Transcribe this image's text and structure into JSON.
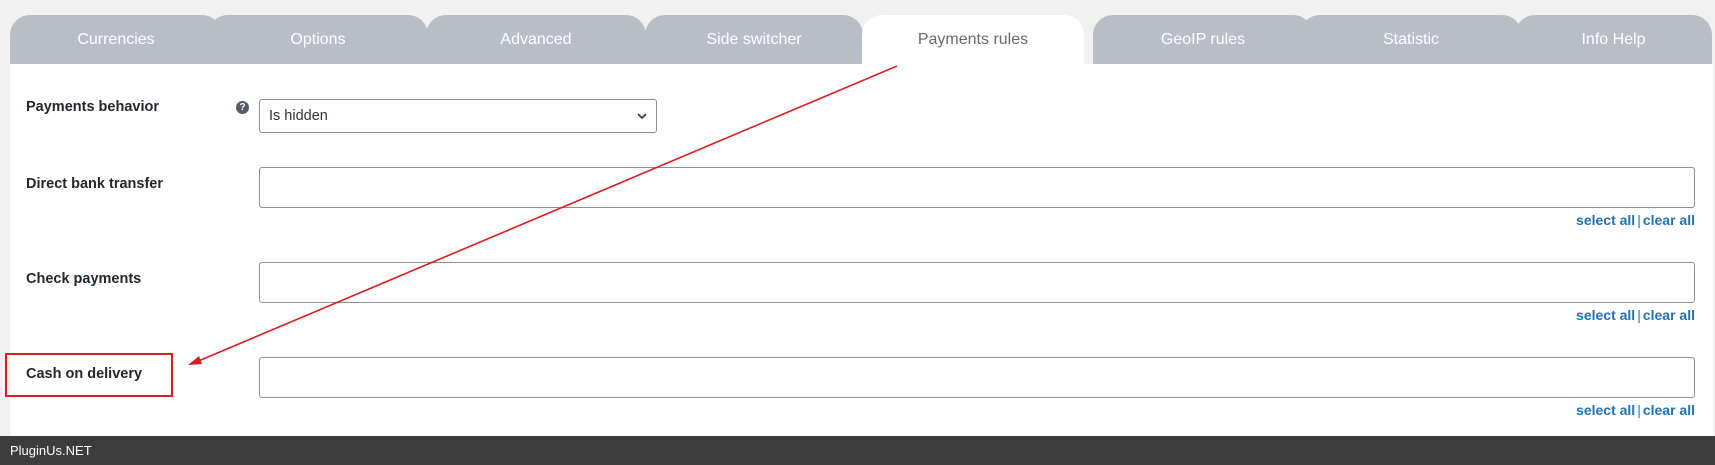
{
  "tabs": [
    {
      "label": "Currencies",
      "active": false
    },
    {
      "label": "Options",
      "active": false
    },
    {
      "label": "Advanced",
      "active": false
    },
    {
      "label": "Side switcher",
      "active": false
    },
    {
      "label": "Payments rules",
      "active": true
    },
    {
      "label": "GeoIP rules",
      "active": false
    },
    {
      "label": "Statistic",
      "active": false
    },
    {
      "label": "Info Help",
      "active": false
    }
  ],
  "form": {
    "behavior": {
      "label": "Payments behavior",
      "help_glyph": "?",
      "selected": "Is hidden"
    },
    "rows": [
      {
        "label": "Direct bank transfer",
        "value": "",
        "select_all": "select all",
        "separator": "|",
        "clear_all": "clear all"
      },
      {
        "label": "Check payments",
        "value": "",
        "select_all": "select all",
        "separator": "|",
        "clear_all": "clear all"
      },
      {
        "label": "Cash on delivery",
        "value": "",
        "select_all": "select all",
        "separator": "|",
        "clear_all": "clear all"
      }
    ]
  },
  "annotation": {
    "color": "#d81f1f"
  },
  "footer": {
    "text": "PluginUs.NET"
  },
  "colors": {
    "tab_bg": "#b9bec4",
    "link": "#2271b1",
    "footer_bg": "#3c3c3c"
  }
}
